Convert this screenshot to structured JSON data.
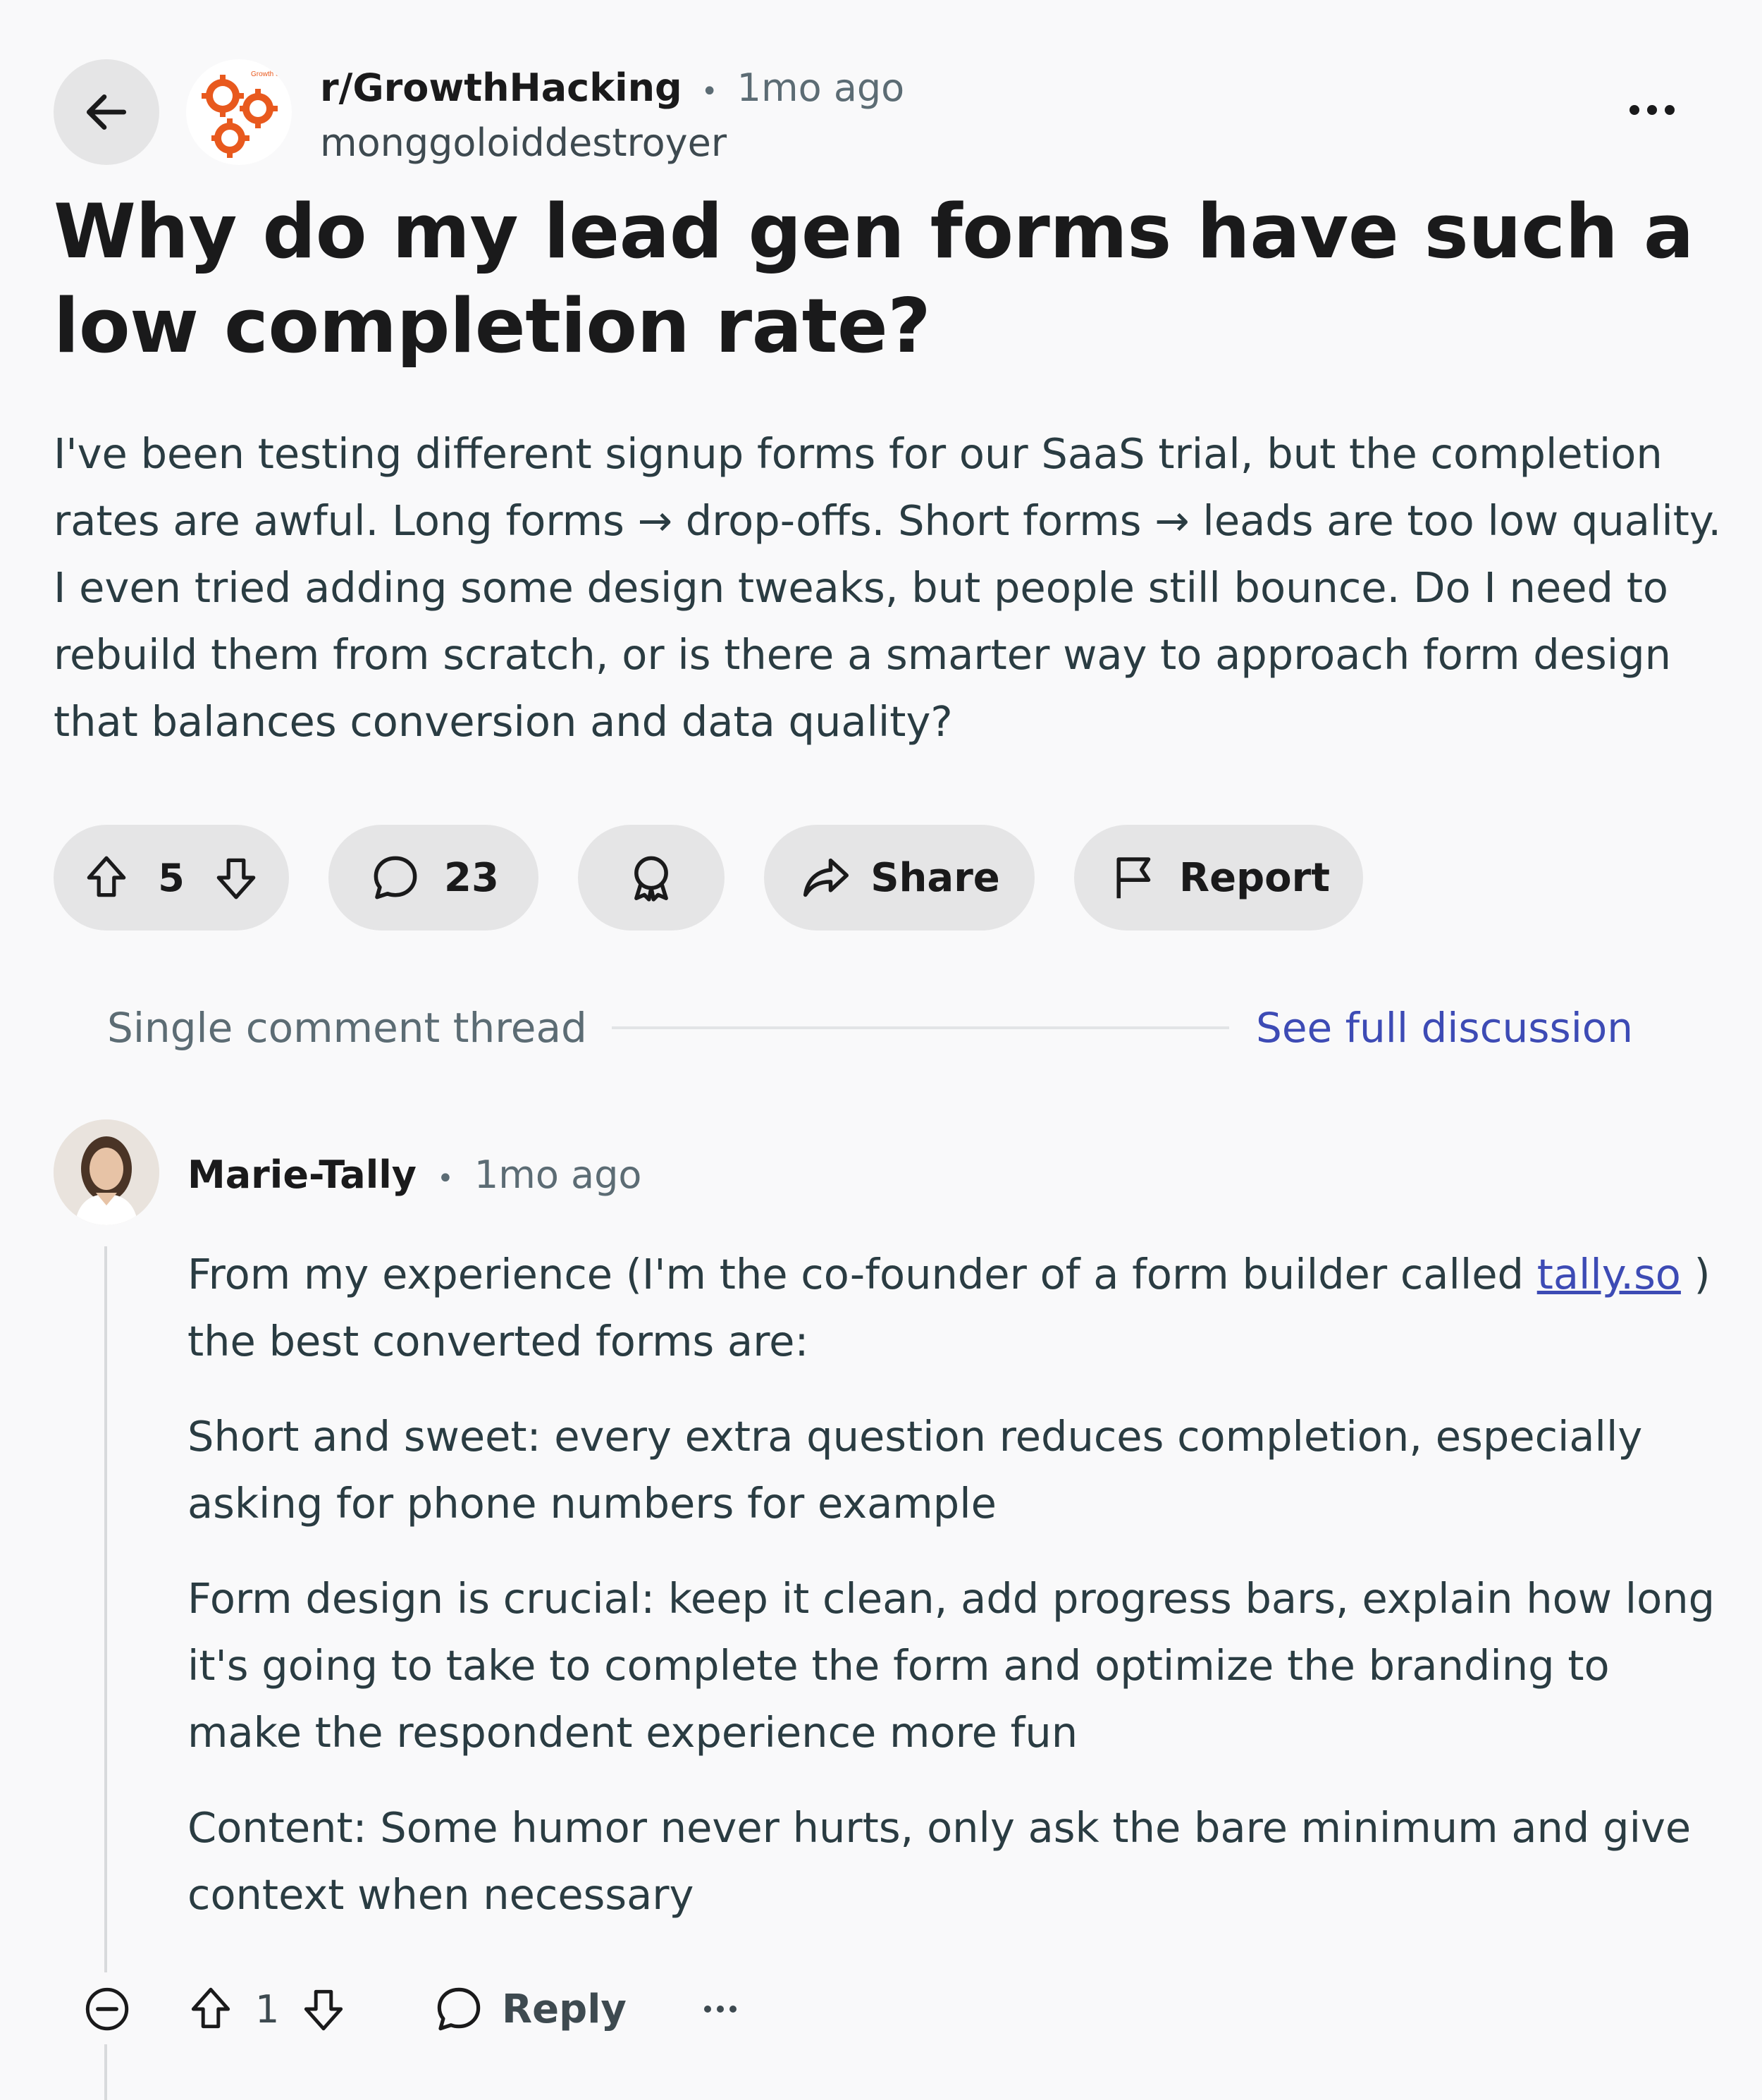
{
  "header": {
    "subreddit": "r/GrowthHacking",
    "separator": "•",
    "time": "1mo ago",
    "author": "monggoloiddestroyer",
    "avatar_text": "Growth Sell",
    "more": "•••"
  },
  "post": {
    "title": "Why do my lead gen forms have such a low completion rate?",
    "body": "I've been testing different signup forms for our SaaS trial, but the completion rates are awful. Long forms → drop-offs. Short forms → leads are too low quality. I even tried adding some design tweaks, but people still bounce. Do I need to rebuild them from scratch, or is there a smarter way to approach form design that balances conversion and data quality?"
  },
  "actions": {
    "votes": "5",
    "comments": "23",
    "share": "Share",
    "report": "Report"
  },
  "thread": {
    "label": "Single comment thread",
    "see_full": "See full discussion"
  },
  "comment": {
    "author": "Marie-Tally",
    "separator": "•",
    "time": "1mo ago",
    "p1_before": "From my experience (I'm the co-founder of a form builder called ",
    "link": "tally.so",
    "p1_after": " ) the best converted forms are:",
    "p2": "Short and sweet: every extra question reduces completion, especially asking for phone numbers for example",
    "p3": "Form design is crucial: keep it clean, add progress bars, explain how long it's going to take to complete the form and optimize the branding to make the respondent experience more fun",
    "p4": "Content: Some humor never hurts, only ask the bare minimum and give context when necessary",
    "votes": "1",
    "reply": "Reply",
    "more": "•••"
  },
  "colors": {
    "background": "#f9f9fa",
    "button_bg": "#e5e5e6",
    "link": "#3d4bb5",
    "text": "#1a1a1b",
    "body_text": "#2a3c42",
    "subreddit_icon": "#e8591e"
  }
}
